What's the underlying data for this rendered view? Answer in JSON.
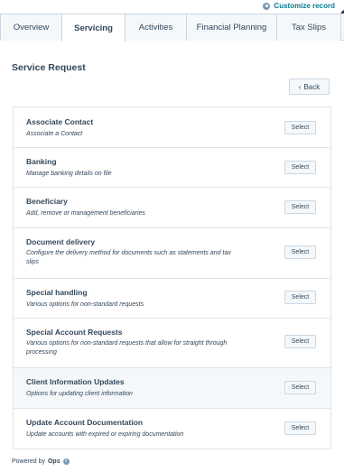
{
  "header": {
    "customize_label": "Customize record",
    "customize_icon": "gear-icon"
  },
  "tabs": [
    {
      "label": "Overview",
      "active": false
    },
    {
      "label": "Servicing",
      "active": true
    },
    {
      "label": "Activities",
      "active": false
    },
    {
      "label": "Financial Planning",
      "active": false
    },
    {
      "label": "Tax Slips",
      "active": false
    }
  ],
  "main": {
    "title": "Service Request",
    "back_label": "Back",
    "back_icon": "chevron-left-icon"
  },
  "requests": [
    {
      "title": "Associate Contact",
      "description": "Associate a Contact",
      "action": "Select"
    },
    {
      "title": "Banking",
      "description": "Manage banking details on file",
      "action": "Select"
    },
    {
      "title": "Beneficiary",
      "description": "Add, remove or management beneficiaries",
      "action": "Select"
    },
    {
      "title": "Document delivery",
      "description": "Configure the delivery method for documents such as statements and tax slips",
      "action": "Select"
    },
    {
      "title": "Special handling",
      "description": "Various options for non-standard requests",
      "action": "Select"
    },
    {
      "title": "Special Account Requests",
      "description": "Various options for non-standard requests that allow for straight through processing",
      "action": "Select"
    },
    {
      "title": "Client Information Updates",
      "description": "Options for updating client information",
      "action": "Select"
    },
    {
      "title": "Update Account Documentation",
      "description": "Update accounts with expired or expiring documentation",
      "action": "Select"
    }
  ],
  "footer": {
    "powered_by": "Powered by",
    "brand": "Ops",
    "info_icon": "info-icon"
  },
  "colors": {
    "text": "#33475b",
    "link": "#0a7b91",
    "border": "#cbd6e2",
    "tab_bg": "#f5f8fa"
  }
}
